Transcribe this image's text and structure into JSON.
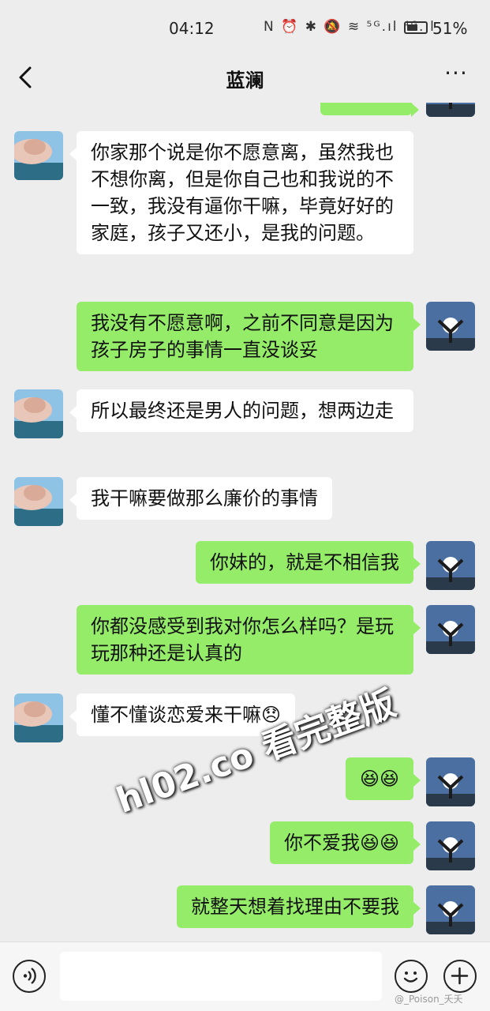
{
  "status": {
    "time": "04:12",
    "icons": "N ⏰ ✱ 🔕 ≋ ⁵ᴳ.ıl ⁴ᴳ.ıl",
    "battery": "51%"
  },
  "header": {
    "title": "蓝澜",
    "more": "···"
  },
  "messages": [
    {
      "side": "in",
      "text": "你家那个说是你不愿意离，虽然我也不想你离，但是你自己也和我说的不一致，我没有逼你干嘛，毕竟好好的家庭，孩子又还小，是我的问题。"
    },
    {
      "side": "out",
      "text": "我没有不愿意啊，之前不同意是因为孩子房子的事情一直没谈妥"
    },
    {
      "side": "in",
      "text": "所以最终还是男人的问题，想两边走"
    },
    {
      "side": "in",
      "text": "我干嘛要做那么廉价的事情"
    },
    {
      "side": "out",
      "text": "你妹的，就是不相信我"
    },
    {
      "side": "out",
      "text": "你都没感受到我对你怎么样吗？是玩玩那种还是认真的"
    },
    {
      "side": "in",
      "text": "懂不懂谈恋爱来干嘛😞"
    },
    {
      "side": "out",
      "text": "😆😆"
    },
    {
      "side": "out",
      "text": "你不爱我😆😆"
    },
    {
      "side": "out",
      "text": "就整天想着找理由不要我"
    }
  ],
  "watermark": "hl02.co 看完整版",
  "credit": "@_Poison_夭夭",
  "colors": {
    "out_bubble": "#95ec69",
    "in_bubble": "#ffffff",
    "background": "#ededed"
  },
  "icons": {
    "back": "chevron-left-icon",
    "voice": "voice-icon",
    "emoji": "emoji-icon",
    "plus": "plus-icon"
  }
}
